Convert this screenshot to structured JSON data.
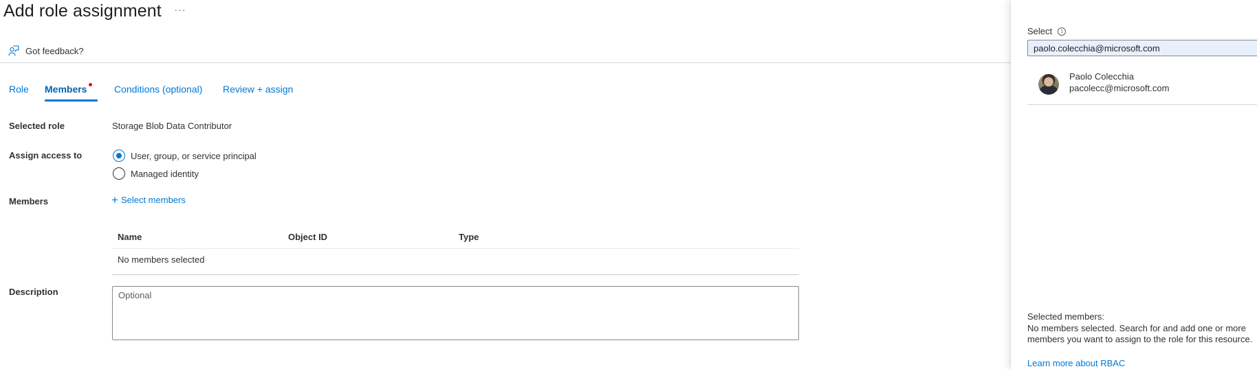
{
  "header": {
    "title": "Add role assignment",
    "more_label": "···",
    "feedback_label": "Got feedback?"
  },
  "tabs": [
    {
      "label": "Role",
      "active": false
    },
    {
      "label": "Members",
      "active": true,
      "has_error_dot": true
    },
    {
      "label": "Conditions (optional)",
      "active": false
    },
    {
      "label": "Review + assign",
      "active": false
    }
  ],
  "form": {
    "selected_role": {
      "label": "Selected role",
      "value": "Storage Blob Data Contributor"
    },
    "assign_access": {
      "label": "Assign access to",
      "options": [
        {
          "label": "User, group, or service principal",
          "checked": true
        },
        {
          "label": "Managed identity",
          "checked": false
        }
      ]
    },
    "members": {
      "label": "Members",
      "select_label": "Select members",
      "table": {
        "columns": [
          "Name",
          "Object ID",
          "Type"
        ],
        "empty_text": "No members selected"
      }
    },
    "description": {
      "label": "Description",
      "placeholder": "Optional",
      "value": ""
    }
  },
  "side_panel": {
    "select_label": "Select",
    "search_value": "paolo.colecchia@microsoft.com",
    "results": [
      {
        "name": "Paolo Colecchia",
        "email": "pacolecc@microsoft.com"
      }
    ],
    "selected_members_label": "Selected members:",
    "selected_members_text": "No members selected. Search for and add one or more members you want to assign to the role for this resource.",
    "learn_more_label": "Learn more about RBAC"
  },
  "colors": {
    "accent": "#0078d4",
    "error_dot": "#e00b1c",
    "autofill_bg": "#e8f0fe"
  }
}
